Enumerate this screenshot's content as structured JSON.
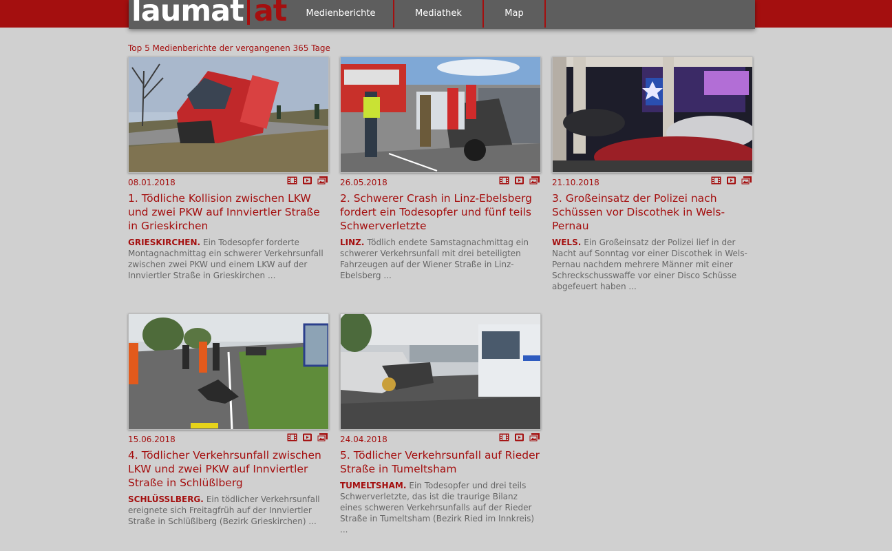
{
  "header": {
    "logo_left": "laumat",
    "logo_right": "at",
    "nav": [
      {
        "label": "Medienberichte"
      },
      {
        "label": "Mediathek"
      },
      {
        "label": "Map"
      }
    ]
  },
  "section": {
    "title": "Top 5 Medienberichte der vergangenen 365 Tage"
  },
  "articles": [
    {
      "date": "08.01.2018",
      "title": "1. Tödliche Kollision zwischen LKW und zwei PKW auf Innviertler Straße in Grieskirchen",
      "location": "GRIESKIRCHEN.",
      "excerpt": "Ein Todesopfer forderte Montagnachmittag ein schwerer Verkehrsunfall zwischen zwei PKW und einem LKW auf der Innviertler Straße in Grieskirchen ..."
    },
    {
      "date": "26.05.2018",
      "title": "2. Schwerer Crash in Linz-Ebelsberg fordert ein Todesopfer und fünf teils Schwerverletzte",
      "location": "LINZ.",
      "excerpt": "Tödlich endete Samstagnachmittag ein schwerer Verkehrsunfall mit drei beteiligten Fahrzeugen auf der Wiener Straße in Linz-Ebelsberg ..."
    },
    {
      "date": "21.10.2018",
      "title": "3. Großeinsatz der Polizei nach Schüssen vor Discothek in Wels-Pernau",
      "location": "WELS.",
      "excerpt": "Ein Großeinsatz der Polizei lief in der Nacht auf Sonntag vor einer Discothek in Wels-Pernau nachdem mehrere Männer mit einer Schreckschusswaffe vor einer Disco Schüsse abgefeuert haben ..."
    },
    {
      "date": "15.06.2018",
      "title": "4. Tödlicher Verkehrsunfall zwischen LKW und zwei PKW auf Innviertler Straße in Schlüßlberg",
      "location": "SCHLÜSSLBERG.",
      "excerpt": "Ein tödlicher Verkehrsunfall ereignete sich Freitagfrüh auf der Innviertler Straße in Schlüßlberg (Bezirk Grieskirchen) ..."
    },
    {
      "date": "24.04.2018",
      "title": "5. Tödlicher Verkehrsunfall auf Rieder Straße in Tumeltsham",
      "location": "TUMELTSHAM.",
      "excerpt": "Ein Todesopfer und drei teils Schwerverletzte, das ist die traurige Bilanz eines schweren Verkehrsunfalls auf der Rieder Straße in Tumeltsham (Bezirk Ried im Innkreis) ..."
    }
  ],
  "icons": [
    "film-icon",
    "video-icon",
    "gallery-icon"
  ],
  "colors": {
    "brand_red": "#a40f0f",
    "nav_gray": "#5e5e5e",
    "page_bg": "#d0d0d0",
    "text_gray": "#666666"
  }
}
